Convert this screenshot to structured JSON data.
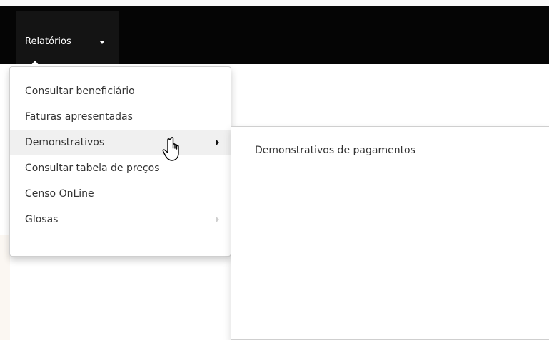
{
  "navbar": {
    "menu_label": "Relatórios"
  },
  "dropdown": {
    "items": [
      {
        "label": "Consultar beneficiário",
        "has_submenu": false
      },
      {
        "label": "Faturas apresentadas",
        "has_submenu": false
      },
      {
        "label": "Demonstrativos",
        "has_submenu": true,
        "active": true
      },
      {
        "label": "Consultar tabela de preços",
        "has_submenu": false
      },
      {
        "label": "Censo OnLine",
        "has_submenu": false
      },
      {
        "label": "Glosas",
        "has_submenu": true,
        "disabled": true
      }
    ]
  },
  "submenu": {
    "items": [
      {
        "label": "Demonstrativos de pagamentos"
      }
    ]
  },
  "colors": {
    "navbar": "#050505",
    "active_item": "#f0f0f0",
    "text": "#333333"
  }
}
